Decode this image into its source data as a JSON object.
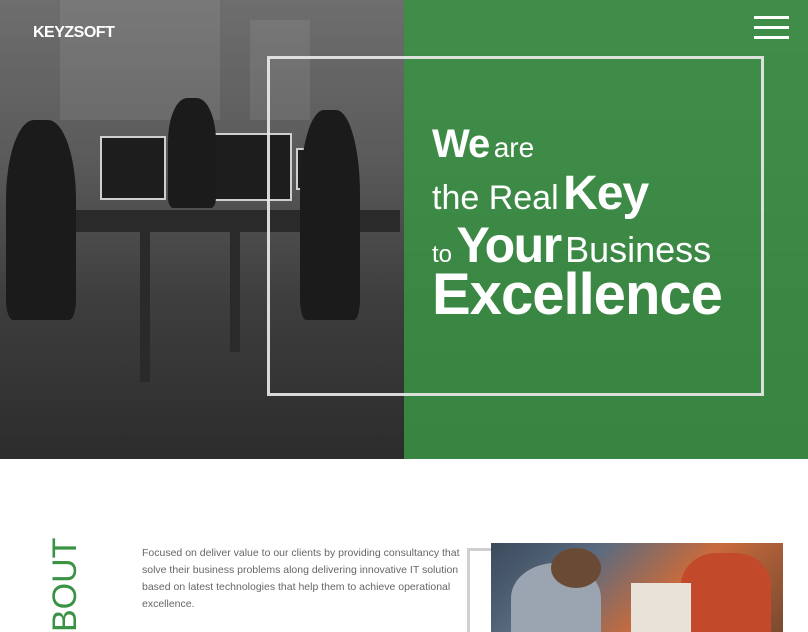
{
  "brand": {
    "logo_text": "KEYZSOFT",
    "accent_color": "#3a9244"
  },
  "nav": {
    "menu_icon": "hamburger-menu-icon"
  },
  "hero": {
    "line1_bold": "We",
    "line1_regular": "are",
    "line2_regular": "the Real",
    "line2_bold": "Key",
    "line3_small": "to",
    "line3_bold": "Your",
    "line3_regular": "Business",
    "line4_bold": "Excellence"
  },
  "about": {
    "title": "BOUT",
    "description": "Focused on deliver value to our clients by providing consultancy that solve their business problems along delivering innovative IT solution based on latest technologies that help them to achieve operational excellence."
  }
}
